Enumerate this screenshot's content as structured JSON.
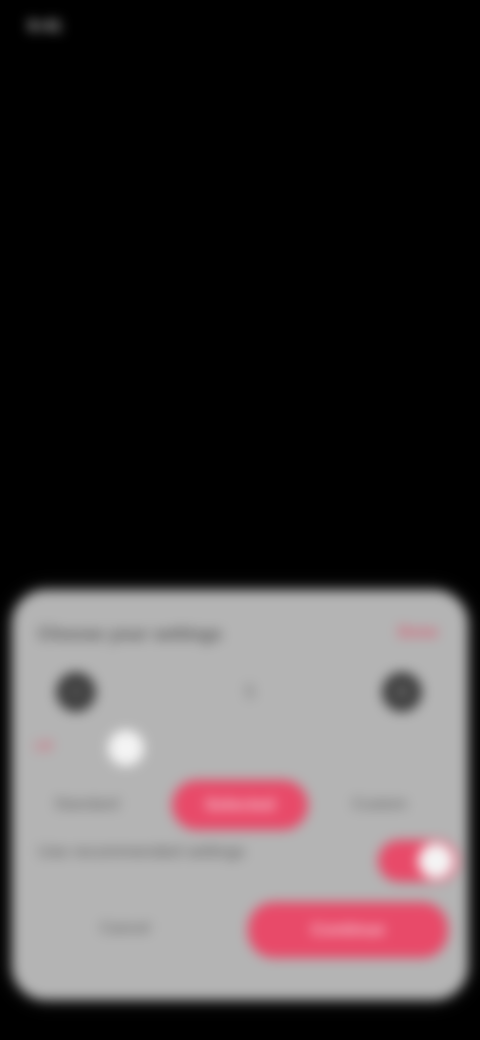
{
  "status_bar": {
    "time": "9:41"
  },
  "sheet": {
    "title": "Choose your settings",
    "top_action": "Done",
    "counter": {
      "decrement_icon": "minus-icon",
      "increment_icon": "plus-icon",
      "value": "5"
    },
    "toggle1": {
      "label": "Off",
      "state": "on",
      "accent": "#e84a69"
    },
    "row1": {
      "left_label": "Standard",
      "pill_label": "Selected",
      "right_label": "Custom"
    },
    "section": {
      "title": "Use recommended settings",
      "toggle_state": "on"
    },
    "footer": {
      "secondary_label": "Cancel",
      "primary_label": "Continue"
    }
  },
  "colors": {
    "accent": "#e84a69",
    "sheet_bg": "#b4b4b4"
  }
}
